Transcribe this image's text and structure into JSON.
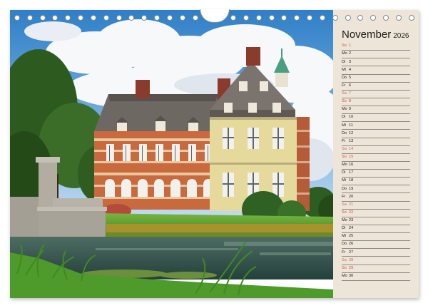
{
  "calendar": {
    "month": "November",
    "year": "2026",
    "days": [
      {
        "abbr": "So",
        "num": "1",
        "type": "sunday"
      },
      {
        "abbr": "Mo",
        "num": "2",
        "type": "weekday"
      },
      {
        "abbr": "Di",
        "num": "3",
        "type": "weekday"
      },
      {
        "abbr": "Mi",
        "num": "4",
        "type": "weekday"
      },
      {
        "abbr": "Do",
        "num": "5",
        "type": "weekday"
      },
      {
        "abbr": "Fr",
        "num": "6",
        "type": "weekday"
      },
      {
        "abbr": "Sa",
        "num": "7",
        "type": "saturday"
      },
      {
        "abbr": "So",
        "num": "8",
        "type": "sunday"
      },
      {
        "abbr": "Mo",
        "num": "9",
        "type": "weekday"
      },
      {
        "abbr": "Di",
        "num": "10",
        "type": "weekday"
      },
      {
        "abbr": "Mi",
        "num": "11",
        "type": "weekday"
      },
      {
        "abbr": "Do",
        "num": "12",
        "type": "weekday"
      },
      {
        "abbr": "Fr",
        "num": "13",
        "type": "weekday"
      },
      {
        "abbr": "Sa",
        "num": "14",
        "type": "saturday"
      },
      {
        "abbr": "So",
        "num": "15",
        "type": "sunday"
      },
      {
        "abbr": "Mo",
        "num": "16",
        "type": "weekday"
      },
      {
        "abbr": "Di",
        "num": "17",
        "type": "weekday"
      },
      {
        "abbr": "Mi",
        "num": "18",
        "type": "weekday"
      },
      {
        "abbr": "Do",
        "num": "19",
        "type": "weekday"
      },
      {
        "abbr": "Fr",
        "num": "20",
        "type": "weekday"
      },
      {
        "abbr": "Sa",
        "num": "21",
        "type": "saturday"
      },
      {
        "abbr": "So",
        "num": "22",
        "type": "sunday"
      },
      {
        "abbr": "Mo",
        "num": "23",
        "type": "weekday"
      },
      {
        "abbr": "Di",
        "num": "24",
        "type": "weekday"
      },
      {
        "abbr": "Mi",
        "num": "25",
        "type": "weekday"
      },
      {
        "abbr": "Do",
        "num": "26",
        "type": "weekday"
      },
      {
        "abbr": "Fr",
        "num": "27",
        "type": "weekday"
      },
      {
        "abbr": "Sa",
        "num": "28",
        "type": "saturday"
      },
      {
        "abbr": "So",
        "num": "29",
        "type": "sunday"
      },
      {
        "abbr": "Mo",
        "num": "30",
        "type": "weekday"
      }
    ]
  },
  "colors": {
    "panel_background": "#ede6d8",
    "sunday_text": "#d6453b",
    "saturday_text": "#c76a5f",
    "weekday_text": "#1c1c1c"
  },
  "photo": {
    "subject": "moated-castle-icon"
  }
}
